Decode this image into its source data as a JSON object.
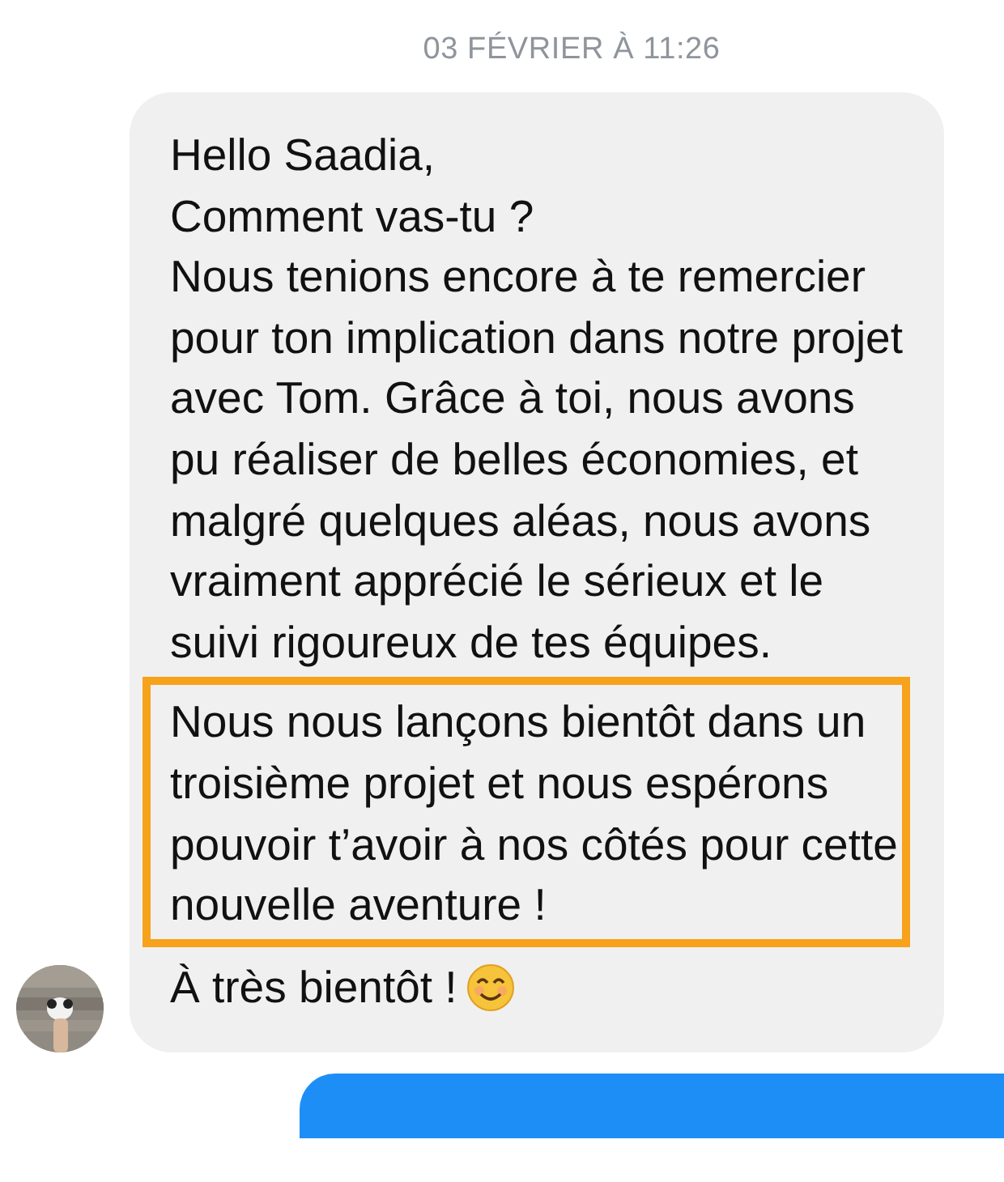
{
  "timestamp": "03 FÉVRIER À 11:26",
  "message": {
    "paragraphs": [
      {
        "text": "Hello Saadia,",
        "highlighted": false
      },
      {
        "text": "Comment vas-tu ?",
        "highlighted": false
      },
      {
        "text": "Nous tenions encore à te remercier pour ton implication dans notre projet avec Tom. Grâce à toi, nous avons pu réaliser de belles économies, et malgré quelques aléas, nous avons vraiment apprécié le sérieux et le suivi rigoureux de tes équipes.",
        "highlighted": false
      },
      {
        "text": "Nous nous lançons bientôt dans un troisième projet et nous espérons pouvoir t’avoir à nos côtés pour cette nouvelle aventure !",
        "highlighted": true
      },
      {
        "text": "À très bientôt !",
        "highlighted": false,
        "emoji": true
      }
    ]
  }
}
